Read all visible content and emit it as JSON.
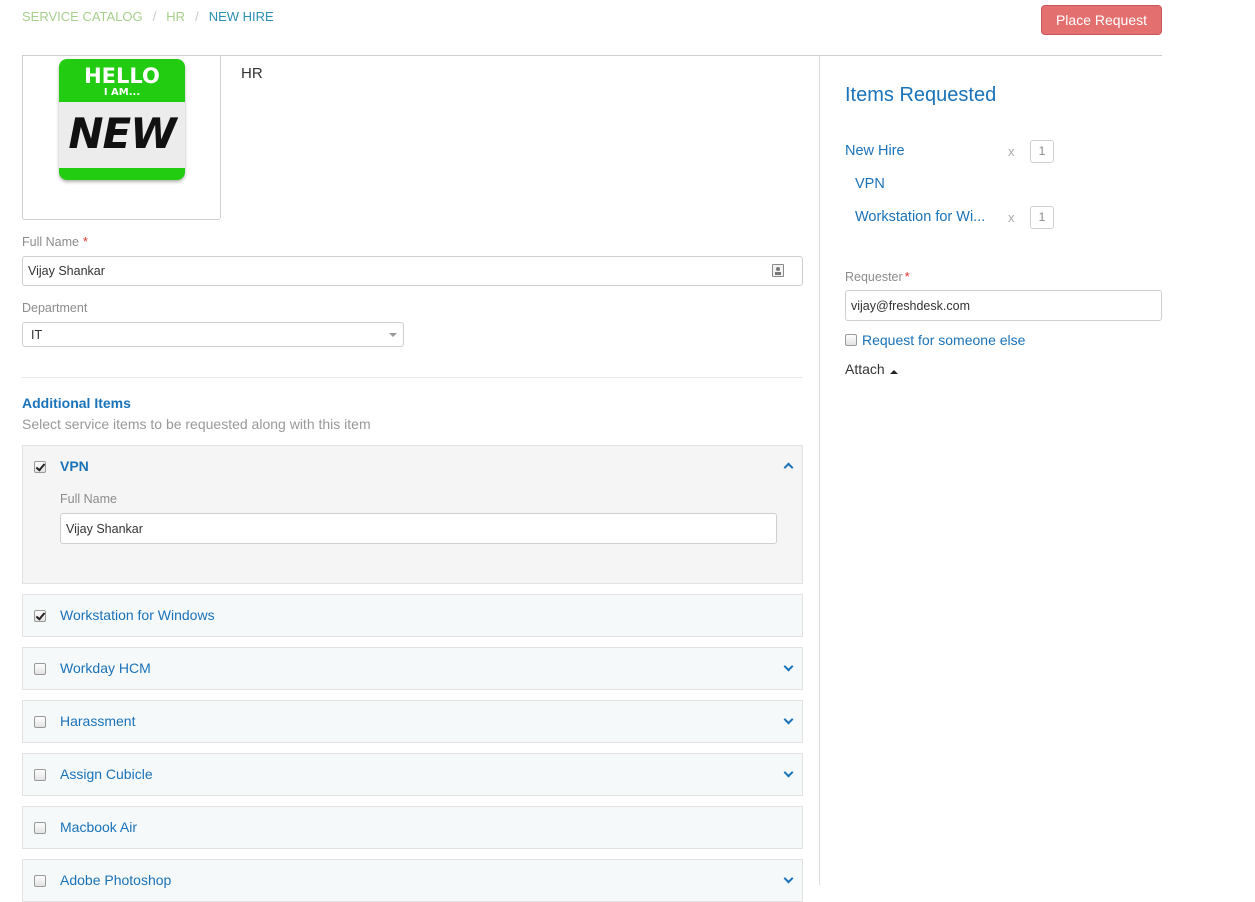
{
  "breadcrumb": [
    {
      "label": "SERVICE CATALOG"
    },
    {
      "label": "HR"
    },
    {
      "label": "NEW HIRE"
    }
  ],
  "breadcrumb_separator": "/",
  "actions": {
    "place_request": "Place Request"
  },
  "item": {
    "image": {
      "line1": "HELLO",
      "line2": "I AM...",
      "line3": "NEW"
    },
    "category": "HR"
  },
  "form": {
    "full_name": {
      "label": "Full Name",
      "required_mark": "*",
      "value": "Vijay Shankar"
    },
    "department": {
      "label": "Department",
      "value": "IT"
    }
  },
  "additional_items": {
    "title": "Additional Items",
    "subtitle": "Select service items to be requested along with this item",
    "items": [
      {
        "label": "VPN",
        "checked": true,
        "expanded": true,
        "fields": [
          {
            "label": "Full Name",
            "value": "Vijay Shankar"
          }
        ]
      },
      {
        "label": "Workstation for Windows",
        "checked": true,
        "expanded": false
      },
      {
        "label": "Workday HCM",
        "checked": false,
        "expanded": false
      },
      {
        "label": "Harassment",
        "checked": false,
        "expanded": false
      },
      {
        "label": "Assign Cubicle",
        "checked": false,
        "expanded": false
      },
      {
        "label": "Macbook Air",
        "checked": false,
        "expanded": false
      },
      {
        "label": "Adobe Photoshop",
        "checked": false,
        "expanded": false
      }
    ]
  },
  "sidebar": {
    "title": "Items Requested",
    "requested": [
      {
        "label": "New Hire",
        "times": "x",
        "quantity": "1"
      },
      {
        "label": "VPN"
      },
      {
        "label": "Workstation for Wi...",
        "times": "x",
        "quantity": "1"
      }
    ],
    "requester": {
      "label": "Requester",
      "required_mark": "*",
      "value": "vijay@freshdesk.com"
    },
    "someone_else": {
      "label": "Request for someone else",
      "checked": false
    },
    "attach": "Attach"
  },
  "colors": {
    "accent": "#1a72b8",
    "place_request": "#e46f6f",
    "breadcrumb_link": "#a7cf8d",
    "breadcrumb_current": "#2b8fb1"
  }
}
